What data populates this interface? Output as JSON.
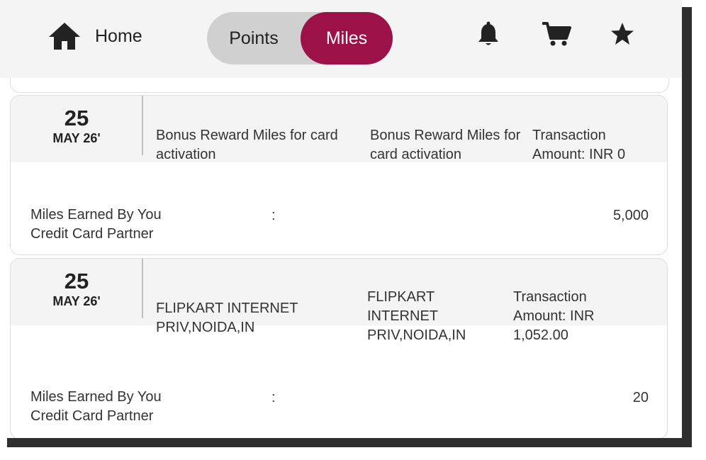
{
  "header": {
    "home_label": "Home",
    "toggle": {
      "points_label": "Points",
      "miles_label": "Miles",
      "selected": "Miles"
    }
  },
  "colors": {
    "accent": "#9c1248",
    "header_bg": "#f3f4f3",
    "toggle_bg": "#d0d0d0"
  },
  "icons": [
    "home-icon",
    "bell-icon",
    "cart-icon",
    "star-icon"
  ],
  "transactions": [
    {
      "day": "25",
      "month": "MAY 26'",
      "description": "Bonus Reward Miles for card activation",
      "description2": "Bonus Reward Miles for card activation",
      "amount": "Transaction Amount: INR 0",
      "earned_label": "Miles Earned By You Credit Card Partner",
      "colon": ":",
      "earned_value": "5,000"
    },
    {
      "day": "25",
      "month": "MAY 26'",
      "description": "FLIPKART INTERNET PRIV,NOIDA,IN",
      "description2": "FLIPKART INTERNET PRIV,NOIDA,IN",
      "amount": "Transaction Amount: INR 1,052.00",
      "earned_label": "Miles Earned By You Credit Card Partner",
      "colon": ":",
      "earned_value": "20"
    }
  ]
}
